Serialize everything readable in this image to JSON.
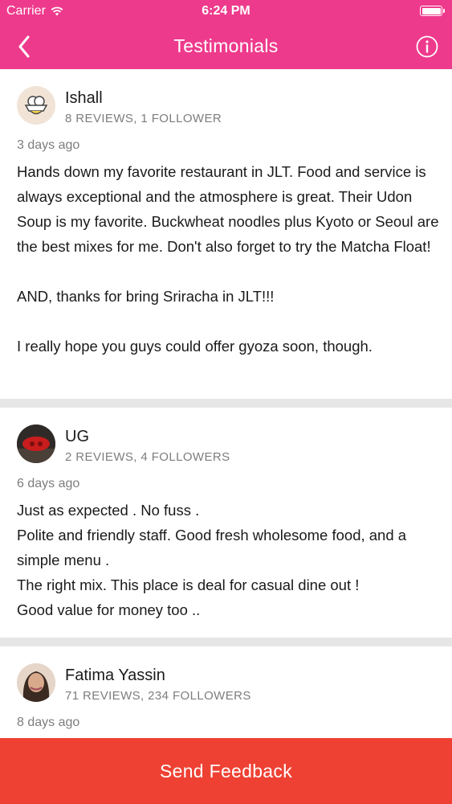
{
  "status_bar": {
    "carrier": "Carrier",
    "time": "6:24 PM"
  },
  "header": {
    "title": "Testimonials",
    "back_icon": "chevron-left-icon",
    "info_icon": "info-circle-icon"
  },
  "reviews": [
    {
      "name": "Ishall",
      "stats": "8 REVIEWS, 1 FOLLOWER",
      "date": "3 days ago",
      "text": "Hands down my favorite restaurant in JLT. Food and service is always exceptional and the atmosphere is great. Their Udon Soup is my favorite. Buckwheat noodles plus Kyoto or Seoul are the best mixes for me. Don't also forget to try the Matcha Float!\n\nAND, thanks for bring Sriracha in JLT!!!\n\nI really hope you guys could offer gyoza soon, though."
    },
    {
      "name": "UG",
      "stats": "2 REVIEWS, 4 FOLLOWERS",
      "date": "6 days ago",
      "text": "Just as expected .  No fuss .\nPolite and friendly staff. Good fresh wholesome food, and a simple menu .\nThe right mix.  This place is deal for casual  dine out !\nGood value for money too .."
    },
    {
      "name": "Fatima Yassin",
      "stats": "71 REVIEWS, 234 FOLLOWERS",
      "date": "8 days ago",
      "text": ""
    }
  ],
  "footer": {
    "button_label": "Send Feedback"
  },
  "colors": {
    "header": "#ee3a8c",
    "footer": "#ee4133",
    "separator": "#e6e6e6"
  }
}
